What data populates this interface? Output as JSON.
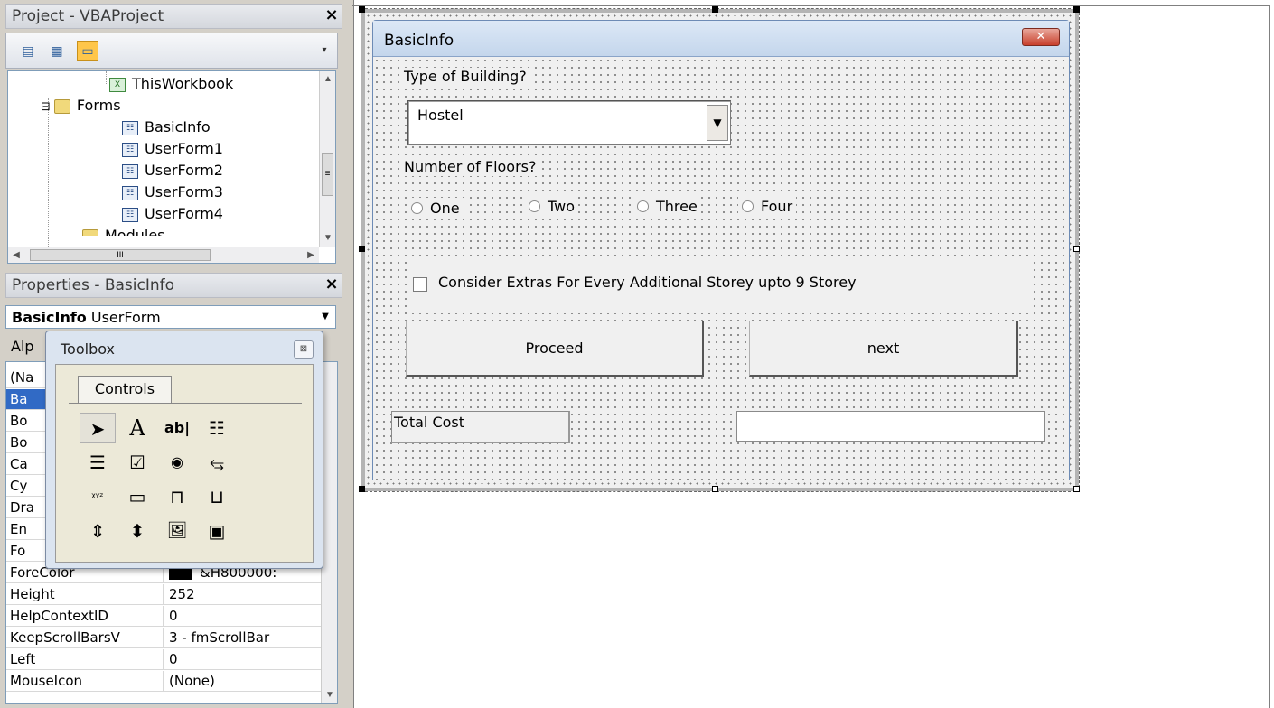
{
  "project_pane": {
    "title": "Project - VBAProject",
    "close": "×",
    "tree": [
      {
        "label": "ThisWorkbook",
        "icon": "excel-sheet-icon"
      },
      {
        "label": "Forms",
        "icon": "folder-icon",
        "expander": "⊟"
      },
      {
        "label": "BasicInfo",
        "icon": "userform-icon"
      },
      {
        "label": "UserForm1",
        "icon": "userform-icon"
      },
      {
        "label": "UserForm2",
        "icon": "userform-icon"
      },
      {
        "label": "UserForm3",
        "icon": "userform-icon"
      },
      {
        "label": "UserForm4",
        "icon": "userform-icon"
      },
      {
        "label": "Modules",
        "icon": "folder-icon"
      }
    ],
    "hscroll_grip": "III"
  },
  "properties_pane": {
    "title": "Properties - BasicInfo",
    "close": "×",
    "object_name": "BasicInfo",
    "object_type": "UserForm",
    "tab_partial": "Alp",
    "rows": [
      {
        "name": "(Na",
        "value": ""
      },
      {
        "name": "Ba",
        "value": ""
      },
      {
        "name": "Bo",
        "value": ""
      },
      {
        "name": "Bo",
        "value": ""
      },
      {
        "name": "Ca",
        "value": ""
      },
      {
        "name": "Cy",
        "value": ""
      },
      {
        "name": "Dra",
        "value": ""
      },
      {
        "name": "En",
        "value": ""
      },
      {
        "name": "Fo",
        "value": ""
      },
      {
        "name": "ForeColor",
        "value": "&H800000:"
      },
      {
        "name": "Height",
        "value": "252"
      },
      {
        "name": "HelpContextID",
        "value": "0"
      },
      {
        "name": "KeepScrollBarsV",
        "value": "3 - fmScrollBar"
      },
      {
        "name": "Left",
        "value": "0"
      },
      {
        "name": "MouseIcon",
        "value": "(None)"
      }
    ]
  },
  "toolbox": {
    "title": "Toolbox",
    "close": "⊠",
    "tab": "Controls",
    "tools": [
      {
        "name": "select-objects-icon",
        "glyph": "➤"
      },
      {
        "name": "label-tool-icon",
        "glyph": "A"
      },
      {
        "name": "textbox-tool-icon",
        "glyph": "ab|"
      },
      {
        "name": "combobox-tool-icon",
        "glyph": "☷"
      },
      {
        "name": "listbox-tool-icon",
        "glyph": "☰"
      },
      {
        "name": "checkbox-tool-icon",
        "glyph": "☑"
      },
      {
        "name": "optionbutton-tool-icon",
        "glyph": "◉"
      },
      {
        "name": "togglebutton-tool-icon",
        "glyph": "⥃"
      },
      {
        "name": "frame-tool-icon",
        "glyph": "ᵡʸᶻ"
      },
      {
        "name": "commandbutton-tool-icon",
        "glyph": "▭"
      },
      {
        "name": "tabstrip-tool-icon",
        "glyph": "⊓"
      },
      {
        "name": "multipage-tool-icon",
        "glyph": "⊔"
      },
      {
        "name": "scrollbar-tool-icon",
        "glyph": "⇕"
      },
      {
        "name": "spinbutton-tool-icon",
        "glyph": "⬍"
      },
      {
        "name": "image-tool-icon",
        "glyph": "🖼"
      },
      {
        "name": "refedit-tool-icon",
        "glyph": "▣"
      }
    ]
  },
  "form": {
    "caption": "BasicInfo",
    "close": "✕",
    "type_label": "Type of Building?",
    "building_type_value": "Hostel",
    "floors_label": "Number of Floors?",
    "floor_options": [
      "One",
      "Two",
      "Three",
      "Four"
    ],
    "extras_checkbox_label": "Consider Extras For Every Additional Storey upto 9 Storey",
    "proceed_button": "Proceed",
    "next_button": "next",
    "total_label": "Total Cost",
    "total_value": ""
  }
}
